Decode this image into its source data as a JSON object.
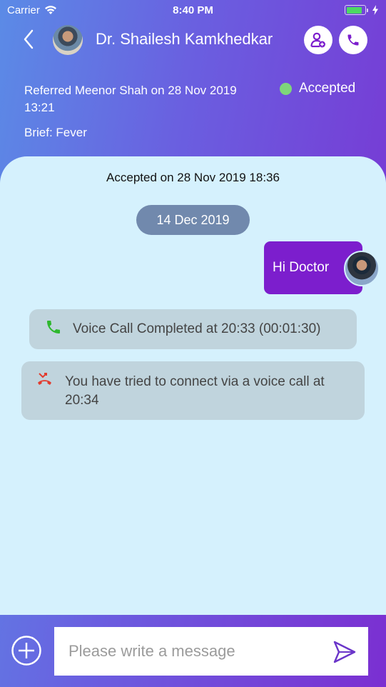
{
  "status_bar": {
    "carrier": "Carrier",
    "time": "8:40 PM",
    "battery_level": 0.85,
    "charging": true
  },
  "header": {
    "back_icon": "chevron-left-icon",
    "doctor_name": "Dr. Shailesh Kamkhedkar",
    "actions": [
      {
        "name": "add-participant",
        "icon": "user-plus-icon"
      },
      {
        "name": "voice-call",
        "icon": "phone-icon"
      }
    ]
  },
  "referral": {
    "text": "Referred Meenor Shah on 28 Nov 2019 13:21",
    "status": "Accepted",
    "status_color": "#7ed67a",
    "brief": "Brief: Fever"
  },
  "chat": {
    "accepted_note": "Accepted on 28 Nov 2019 18:36",
    "date_separator": "14 Dec 2019",
    "messages": [
      {
        "type": "outgoing",
        "text": "Hi Doctor"
      },
      {
        "type": "system",
        "icon": "phone-icon",
        "icon_color": "#2eb82e",
        "text": "Voice Call Completed at 20:33 (00:01:30)"
      },
      {
        "type": "system",
        "icon": "missed-call-icon",
        "icon_color": "#e23b2e",
        "text": "You have tried to connect via a voice call at 20:34"
      }
    ]
  },
  "composer": {
    "placeholder": "Please write a message",
    "value": "",
    "attach_icon": "plus-circle-icon",
    "send_icon": "send-icon"
  },
  "colors": {
    "accent": "#7c1ecd",
    "chat_background": "#d5f1fd",
    "date_pill": "#7189ad",
    "system_bubble": "#c0d4dd"
  }
}
